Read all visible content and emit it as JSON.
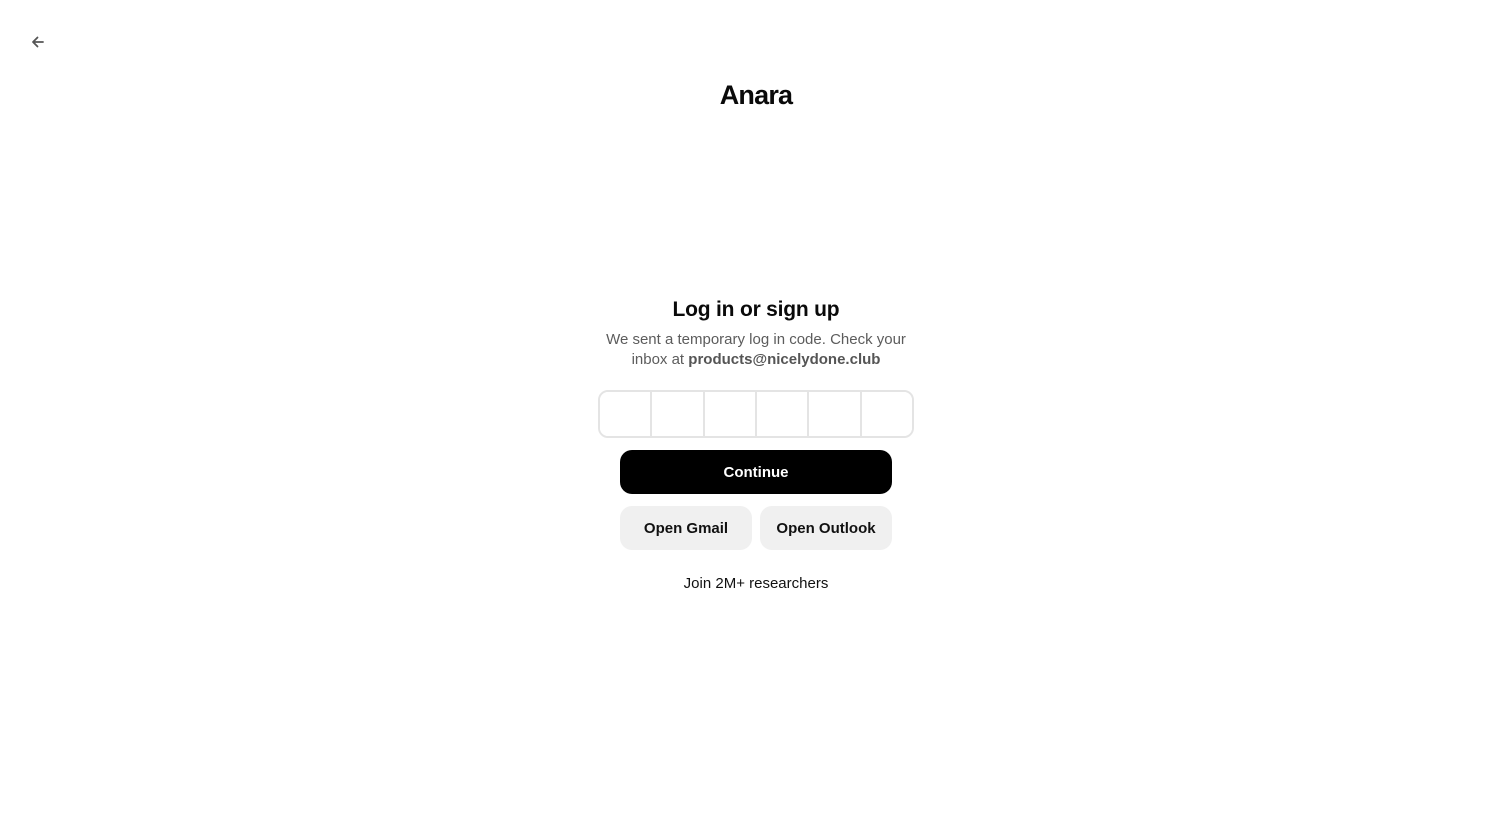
{
  "nav": {
    "back_icon": "arrow-left-icon"
  },
  "brand": {
    "name": "Anara"
  },
  "auth": {
    "title": "Log in or sign up",
    "subtitle_prefix": "We sent a temporary log in code. Check your inbox at ",
    "email": "products@nicelydone.club",
    "code_digits": [
      "",
      "",
      "",
      "",
      "",
      ""
    ],
    "continue_label": "Continue",
    "open_gmail_label": "Open Gmail",
    "open_outlook_label": "Open Outlook",
    "footer_text": "Join 2M+ researchers"
  },
  "colors": {
    "primary_button": "#000000",
    "secondary_button": "#f0f0f0",
    "input_border": "#e4e4e4",
    "subtitle_text": "#5c5c5c"
  }
}
